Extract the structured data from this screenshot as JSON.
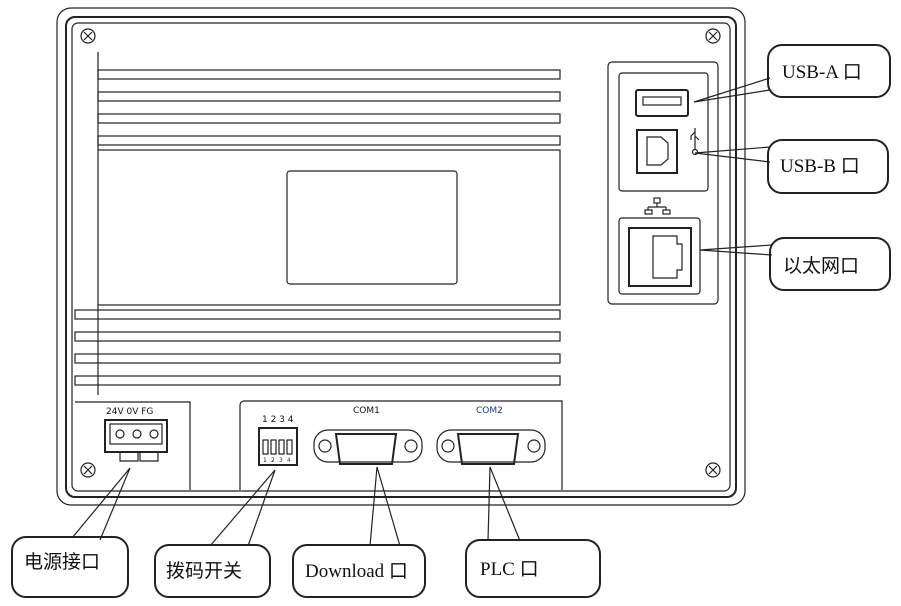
{
  "panel_labels": {
    "power_terminals": "24V  0V  FG",
    "dip_numbers_top": "1 2 3 4",
    "dip_numbers_bottom": [
      "1",
      "2",
      "3",
      "4"
    ],
    "com1": "COM1",
    "com2": "COM2"
  },
  "callouts": {
    "usb_a": "USB-A 口",
    "usb_b": "USB-B 口",
    "ethernet": "以太网口",
    "power": "电源接口",
    "dip_switch": "拨码开关",
    "download": "Download 口",
    "plc": "PLC 口"
  },
  "icons": [
    "screw-icon",
    "usb-icon",
    "network-icon"
  ]
}
